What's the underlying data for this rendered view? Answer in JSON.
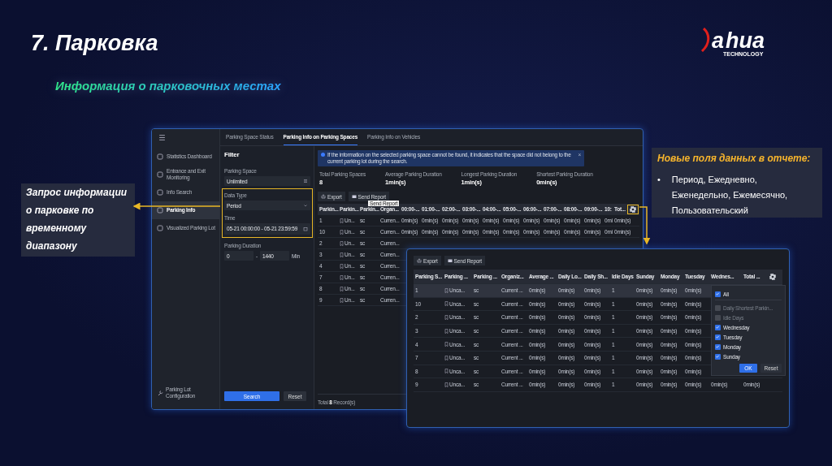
{
  "slide": {
    "title": "7. Парковка",
    "subtitle": "Информация о парковочных местах",
    "logo": {
      "letter": "a",
      "word": "hua",
      "tagline": "TECHNOLOGY"
    }
  },
  "left_callout": {
    "text": "Запрос информации о парковке по временному диапазону"
  },
  "right_callout": {
    "title": "Новые поля данных в отчете:",
    "bullets": [
      {
        "mark": "•",
        "text": "Период, Ежедневно, Еженедельно, Ежемесячно, Пользовательский"
      }
    ]
  },
  "window": {
    "sidebar": {
      "items": [
        {
          "label": "Statistics Dashboard",
          "selected": false
        },
        {
          "label": "Entrance and Exit Monitoring",
          "selected": false
        },
        {
          "label": "Info Search",
          "selected": false
        },
        {
          "label": "Parking Info",
          "selected": true
        },
        {
          "label": "Visualized Parking Lot",
          "selected": false
        }
      ],
      "footer": "Parking Lot Configuration"
    },
    "tabs": [
      {
        "label": "Parking Space Status",
        "selected": false
      },
      {
        "label": "Parking Info on Parking Spaces",
        "selected": true
      },
      {
        "label": "Parking Info on Vehicles",
        "selected": false
      }
    ],
    "filter": {
      "title": "Filter",
      "parking_space": {
        "label": "Parking Space",
        "value": "Unlimited"
      },
      "data_type": {
        "label": "Data Type",
        "value": "Period"
      },
      "time": {
        "label": "Time",
        "value": "05-21 00:00:00 - 05-21 23:59:59"
      },
      "duration": {
        "label": "Parking Duration",
        "from": "0",
        "separator": "-",
        "to": "1440",
        "unit": "Min"
      },
      "buttons": [
        "Search",
        "Reset"
      ]
    },
    "notice": {
      "text": "If the information on the selected parking space cannot be found, it indicates that the space did not belong to the current parking lot during the search.",
      "close": "×"
    },
    "stats": [
      {
        "label": "Total Parking Spaces",
        "value": "8"
      },
      {
        "label": "Average Parking Duration",
        "value": "1min(s)"
      },
      {
        "label": "Longest Parking Duration",
        "value": "1min(s)"
      },
      {
        "label": "Shortest Parking Duration",
        "value": "0min(s)"
      }
    ],
    "toolbar": {
      "export": "Export",
      "send_report": "Send Report",
      "tooltip": "Send Report"
    },
    "table": {
      "columns": [
        "Parkin...",
        "Parkin...",
        "Parkin...",
        "Organ...",
        "00:00-...",
        "01:00-...",
        "02:00-...",
        "03:00-...",
        "04:00-...",
        "05:00-...",
        "06:00-...",
        "07:00-...",
        "08:00-...",
        "09:00-...",
        "10:",
        "Tot..."
      ],
      "rows": [
        {
          "cells": [
            "1",
            "Un...",
            "sc",
            "Curren...",
            "0min(s)",
            "0min(s)",
            "0min(s)",
            "0min(s)",
            "0min(s)",
            "0min(s)",
            "0min(s)",
            "0min(s)",
            "0min(s)",
            "0min(s)",
            "0mi",
            "0min(s)"
          ]
        },
        {
          "cells": [
            "10",
            "Un...",
            "sc",
            "Curren...",
            "0min(s)",
            "0min(s)",
            "0min(s)",
            "0min(s)",
            "0min(s)",
            "0min(s)",
            "0min(s)",
            "0min(s)",
            "0min(s)",
            "0min(s)",
            "0mi",
            "0min(s)"
          ]
        },
        {
          "cells": [
            "2",
            "Un...",
            "sc",
            "Curren..."
          ]
        },
        {
          "cells": [
            "3",
            "Un...",
            "sc",
            "Curren..."
          ]
        },
        {
          "cells": [
            "4",
            "Un...",
            "sc",
            "Curren..."
          ]
        },
        {
          "cells": [
            "7",
            "Un...",
            "sc",
            "Curren..."
          ]
        },
        {
          "cells": [
            "8",
            "Un...",
            "sc",
            "Curren..."
          ]
        },
        {
          "cells": [
            "9",
            "Un...",
            "sc",
            "Curren..."
          ]
        }
      ]
    },
    "footer": "Total **8** Record(s)"
  },
  "report_window": {
    "toolbar": {
      "export": "Export",
      "send_report": "Send Report"
    },
    "table": {
      "columns": [
        "Parking S...",
        "Parking ...",
        "Parking ...",
        "Organiz...",
        "Average ...",
        "Daily Lo...",
        "Daily Sh...",
        "Idle Days",
        "Sunday",
        "Monday",
        "Tuesday",
        "Wednes...",
        "Total ..."
      ],
      "rows": [
        {
          "selected": true,
          "cells": [
            "1",
            "Unca...",
            "sc",
            "Current ...",
            "0min(s)",
            "0min(s)",
            "0min(s)",
            "1",
            "0min(s)",
            "0min(s)",
            "0min(s)"
          ]
        },
        {
          "selected": false,
          "cells": [
            "10",
            "Unca...",
            "sc",
            "Current ...",
            "0min(s)",
            "0min(s)",
            "0min(s)",
            "1",
            "0min(s)",
            "0min(s)",
            "0min(s)"
          ]
        },
        {
          "selected": false,
          "cells": [
            "2",
            "Unca...",
            "sc",
            "Current ...",
            "0min(s)",
            "0min(s)",
            "0min(s)",
            "1",
            "0min(s)",
            "0min(s)",
            "0min(s)"
          ]
        },
        {
          "selected": false,
          "cells": [
            "3",
            "Unca...",
            "sc",
            "Current ...",
            "0min(s)",
            "0min(s)",
            "0min(s)",
            "1",
            "0min(s)",
            "0min(s)",
            "0min(s)"
          ]
        },
        {
          "selected": false,
          "cells": [
            "4",
            "Unca...",
            "sc",
            "Current ...",
            "0min(s)",
            "0min(s)",
            "0min(s)",
            "1",
            "0min(s)",
            "0min(s)",
            "0min(s)"
          ]
        },
        {
          "selected": false,
          "cells": [
            "7",
            "Unca...",
            "sc",
            "Current ...",
            "0min(s)",
            "0min(s)",
            "0min(s)",
            "1",
            "0min(s)",
            "0min(s)",
            "0min(s)"
          ]
        },
        {
          "selected": false,
          "cells": [
            "8",
            "Unca...",
            "sc",
            "Current ...",
            "0min(s)",
            "0min(s)",
            "0min(s)",
            "1",
            "0min(s)",
            "0min(s)",
            "0min(s)"
          ]
        },
        {
          "selected": false,
          "cells": [
            "9",
            "Unca...",
            "sc",
            "Current ...",
            "0min(s)",
            "0min(s)",
            "0min(s)",
            "1",
            "0min(s)",
            "0min(s)",
            "0min(s)",
            "0min(s)",
            "0min(s)"
          ]
        }
      ]
    },
    "column_menu": {
      "items": [
        {
          "label": "All",
          "checked": true,
          "disabled": false
        },
        {
          "label": "Daily Shortest Parkin...",
          "checked": false,
          "disabled": true
        },
        {
          "label": "Idle Days",
          "checked": false,
          "disabled": true
        },
        {
          "label": "Wednesday",
          "checked": true,
          "disabled": false
        },
        {
          "label": "Tuesday",
          "checked": true,
          "disabled": false
        },
        {
          "label": "Monday",
          "checked": true,
          "disabled": false
        },
        {
          "label": "Sunday",
          "checked": true,
          "disabled": false
        }
      ],
      "buttons": [
        "OK",
        "Reset"
      ]
    }
  }
}
